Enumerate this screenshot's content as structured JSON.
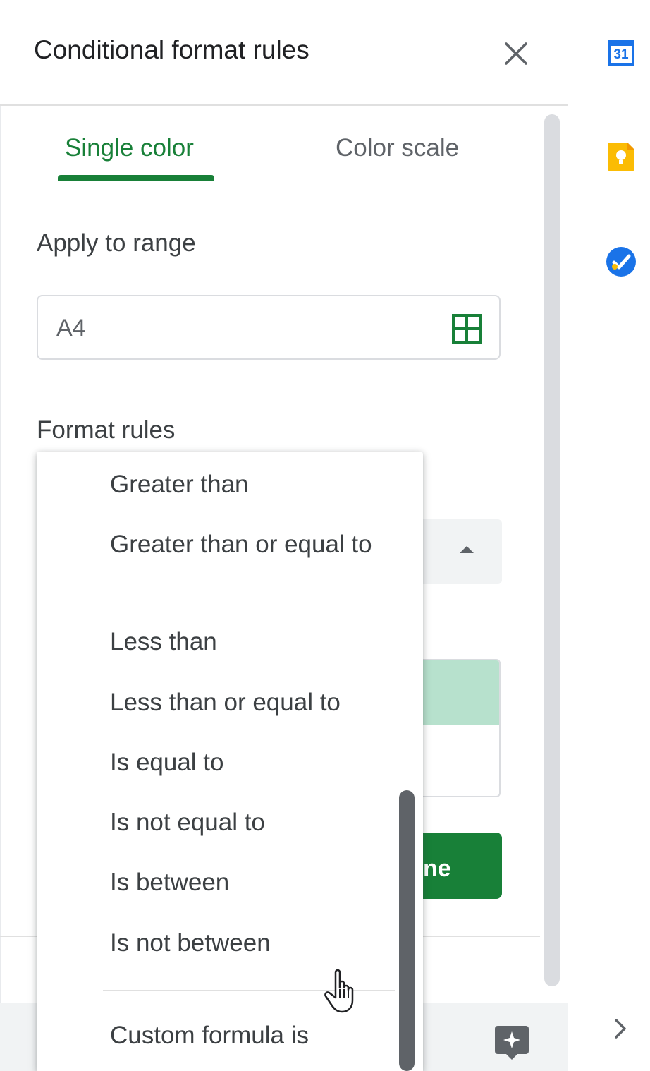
{
  "panel": {
    "title": "Conditional format rules"
  },
  "tabs": [
    {
      "label": "Single color",
      "active": true
    },
    {
      "label": "Color scale",
      "active": false
    }
  ],
  "apply_to_range": {
    "label": "Apply to range",
    "value": "A4"
  },
  "format_rules": {
    "label": "Format rules"
  },
  "buttons": {
    "done_partial": "ne"
  },
  "dropdown": {
    "options": [
      "Greater than",
      "Greater than or equal to",
      "Less than",
      "Less than or equal to",
      "Is equal to",
      "Is not equal to",
      "Is between",
      "Is not between",
      "Custom formula is"
    ]
  },
  "side_panel": {
    "calendar_day": "31",
    "icons": [
      "calendar-icon",
      "keep-icon",
      "tasks-icon",
      "chevron-right-icon"
    ]
  },
  "colors": {
    "accent_green": "#188038",
    "preview_fill": "#b7e1cd",
    "calendar_blue": "#1a73e8",
    "keep_yellow": "#fbbc04"
  }
}
